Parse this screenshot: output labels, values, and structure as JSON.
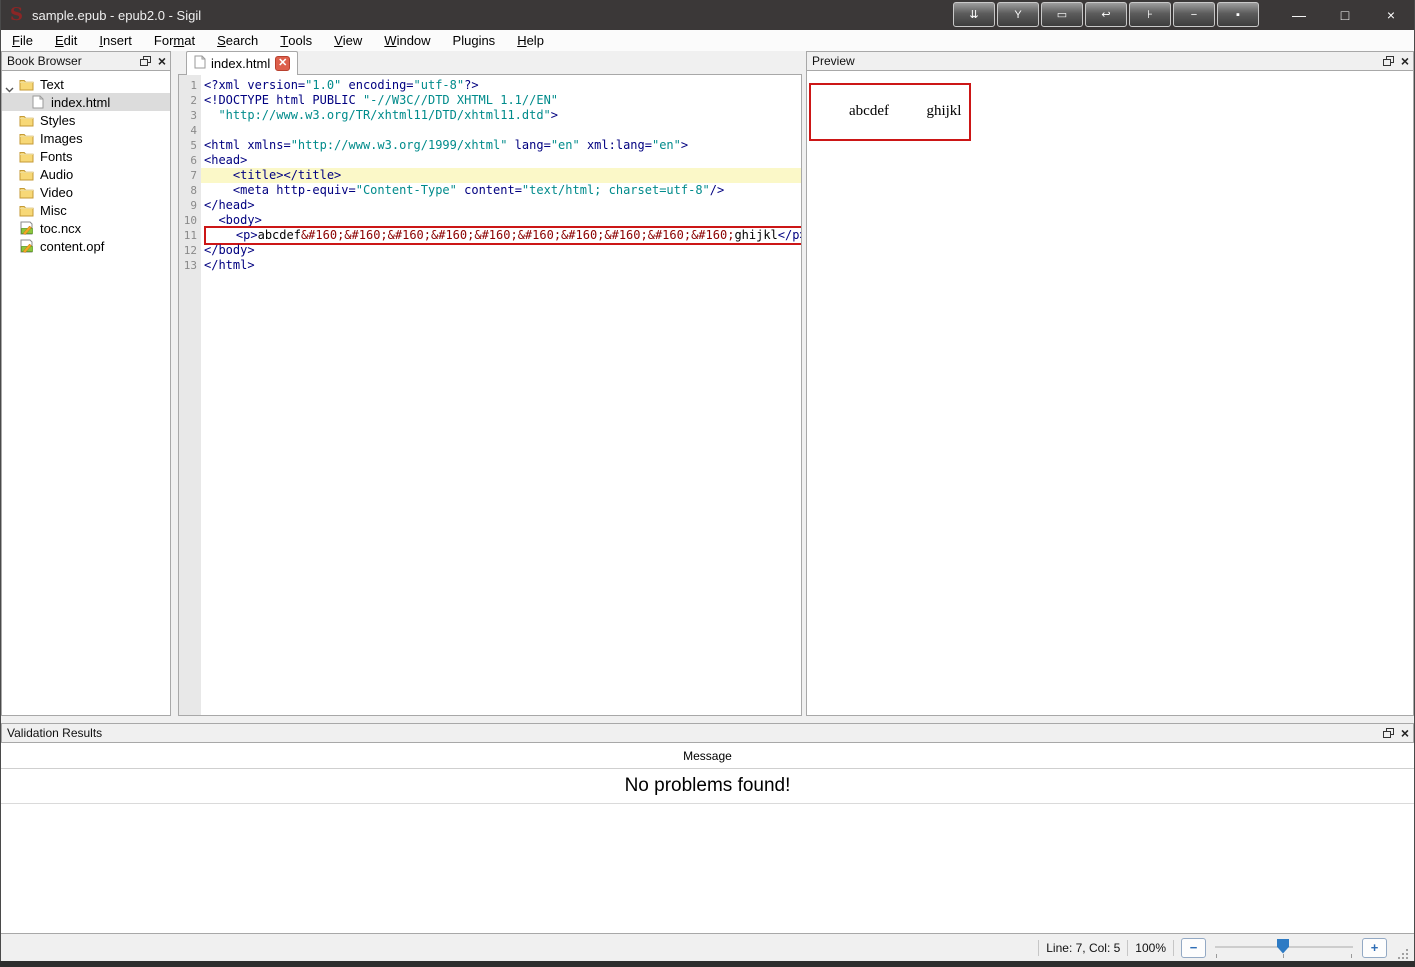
{
  "window": {
    "title": "sample.epub - epub2.0 - Sigil",
    "logo_letter": "S"
  },
  "window_controls": {
    "minimize": "—",
    "maximize": "□",
    "close": "×"
  },
  "titlebar_toolbar": [
    {
      "name": "chevrons-down",
      "glyph": "⇊"
    },
    {
      "name": "wrench",
      "glyph": "Y"
    },
    {
      "name": "screen",
      "glyph": "▭"
    },
    {
      "name": "undo",
      "glyph": "↩"
    },
    {
      "name": "pin",
      "glyph": "⊦"
    },
    {
      "name": "dash",
      "glyph": "−"
    },
    {
      "name": "dot",
      "glyph": "▪"
    }
  ],
  "menubar": {
    "items": [
      {
        "label": "File",
        "u": 0
      },
      {
        "label": "Edit",
        "u": 0
      },
      {
        "label": "Insert",
        "u": 0
      },
      {
        "label": "Format",
        "u": 3
      },
      {
        "label": "Search",
        "u": 0
      },
      {
        "label": "Tools",
        "u": 0
      },
      {
        "label": "View",
        "u": 0
      },
      {
        "label": "Window",
        "u": 0
      },
      {
        "label": "Plugins",
        "u": -1
      },
      {
        "label": "Help",
        "u": 0
      }
    ]
  },
  "book_browser": {
    "title": "Book Browser",
    "items": [
      {
        "label": "Text",
        "icon": "folder",
        "level": 0,
        "expanded": true
      },
      {
        "label": "index.html",
        "icon": "file",
        "level": 1,
        "selected": true
      },
      {
        "label": "Styles",
        "icon": "folder",
        "level": 0
      },
      {
        "label": "Images",
        "icon": "folder",
        "level": 0
      },
      {
        "label": "Fonts",
        "icon": "folder",
        "level": 0
      },
      {
        "label": "Audio",
        "icon": "folder",
        "level": 0
      },
      {
        "label": "Video",
        "icon": "folder",
        "level": 0
      },
      {
        "label": "Misc",
        "icon": "folder",
        "level": 0
      },
      {
        "label": "toc.ncx",
        "icon": "doc",
        "level": 0
      },
      {
        "label": "content.opf",
        "icon": "doc",
        "level": 0
      }
    ]
  },
  "editor": {
    "tab_label": "index.html",
    "lines": [
      {
        "num": 1,
        "segments": [
          {
            "t": "tag",
            "v": "<?xml version="
          },
          {
            "t": "str",
            "v": "\"1.0\""
          },
          {
            "t": "tag",
            "v": " encoding="
          },
          {
            "t": "str",
            "v": "\"utf-8\""
          },
          {
            "t": "tag",
            "v": "?>"
          }
        ]
      },
      {
        "num": 2,
        "segments": [
          {
            "t": "tag",
            "v": "<!DOCTYPE html PUBLIC "
          },
          {
            "t": "str",
            "v": "\"-//W3C//DTD XHTML 1.1//EN\""
          }
        ]
      },
      {
        "num": 3,
        "segments": [
          {
            "t": "txt",
            "v": "  "
          },
          {
            "t": "str",
            "v": "\"http://www.w3.org/TR/xhtml11/DTD/xhtml11.dtd\""
          },
          {
            "t": "tag",
            "v": ">"
          }
        ]
      },
      {
        "num": 4,
        "segments": []
      },
      {
        "num": 5,
        "segments": [
          {
            "t": "tag",
            "v": "<html xmlns="
          },
          {
            "t": "str",
            "v": "\"http://www.w3.org/1999/xhtml\""
          },
          {
            "t": "tag",
            "v": " lang="
          },
          {
            "t": "str",
            "v": "\"en\""
          },
          {
            "t": "tag",
            "v": " xml:lang="
          },
          {
            "t": "str",
            "v": "\"en\""
          },
          {
            "t": "tag",
            "v": ">"
          }
        ]
      },
      {
        "num": 6,
        "segments": [
          {
            "t": "tag",
            "v": "<head>"
          }
        ]
      },
      {
        "num": 7,
        "current": true,
        "segments": [
          {
            "t": "txt",
            "v": "    "
          },
          {
            "t": "tag",
            "v": "<title></title>"
          }
        ]
      },
      {
        "num": 8,
        "segments": [
          {
            "t": "txt",
            "v": "    "
          },
          {
            "t": "tag",
            "v": "<meta http-equiv="
          },
          {
            "t": "str",
            "v": "\"Content-Type\""
          },
          {
            "t": "tag",
            "v": " content="
          },
          {
            "t": "str",
            "v": "\"text/html; charset=utf-8\""
          },
          {
            "t": "tag",
            "v": "/>"
          }
        ]
      },
      {
        "num": 9,
        "segments": [
          {
            "t": "tag",
            "v": "</head>"
          }
        ]
      },
      {
        "num": 10,
        "segments": [
          {
            "t": "txt",
            "v": "  "
          },
          {
            "t": "tag",
            "v": "<body>"
          }
        ]
      },
      {
        "num": 11,
        "marked": true,
        "segments": [
          {
            "t": "txt",
            "v": "    "
          },
          {
            "t": "tag",
            "v": "<p>"
          },
          {
            "t": "txt",
            "v": "abcdef"
          },
          {
            "t": "ent",
            "v": "&#160;&#160;&#160;&#160;&#160;&#160;&#160;&#160;&#160;&#160;"
          },
          {
            "t": "txt",
            "v": "ghijkl"
          },
          {
            "t": "tag",
            "v": "</p>"
          }
        ]
      },
      {
        "num": 12,
        "segments": [
          {
            "t": "tag",
            "v": "</body>"
          }
        ]
      },
      {
        "num": 13,
        "segments": [
          {
            "t": "tag",
            "v": "</html>"
          }
        ]
      }
    ]
  },
  "preview": {
    "title": "Preview",
    "text_left": "abcdef",
    "text_right": "ghijkl",
    "nbsp_count": 10
  },
  "validation": {
    "title": "Validation Results",
    "column_header": "Message",
    "message": "No problems found!"
  },
  "statusbar": {
    "position": "Line: 7, Col: 5",
    "zoom": "100%",
    "zoom_out": "−",
    "zoom_in": "+"
  },
  "colors": {
    "marker_box_red": "#cc1616",
    "syntax_tag": "#000080",
    "syntax_string": "#008b8b",
    "syntax_entity": "#8b0000",
    "current_line_bg": "#fbf8c8",
    "titlebar_bg": "#3b3838",
    "slider_handle_blue": "#2e7bc4"
  }
}
